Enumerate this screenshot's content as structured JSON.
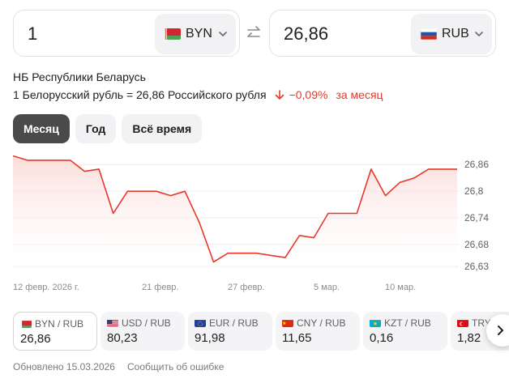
{
  "converter": {
    "from_amount": "1",
    "from_currency": "BYN",
    "to_amount": "26,86",
    "to_currency": "RUB"
  },
  "info": {
    "source": "НБ Республики Беларусь",
    "rate_text": "1 Белорусский рубль = 26,86 Российского рубля",
    "change": "−0,09%",
    "change_period": "за месяц"
  },
  "periods": [
    {
      "label": "Месяц",
      "active": true
    },
    {
      "label": "Год",
      "active": false
    },
    {
      "label": "Всё время",
      "active": false
    }
  ],
  "chart_data": {
    "type": "area",
    "title": "",
    "xlabel": "",
    "ylabel": "",
    "ylim": [
      26.61,
      26.89
    ],
    "y_ticks": [
      "26,86",
      "26,8",
      "26,74",
      "26,68",
      "26,63"
    ],
    "y_tick_values": [
      26.86,
      26.8,
      26.74,
      26.68,
      26.63
    ],
    "x_tick_labels": [
      "12 февр. 2026 г.",
      "21 февр.",
      "27 февр.",
      "5 мар.",
      "10 мар."
    ],
    "series": [
      {
        "values": [
          26.88,
          26.87,
          26.87,
          26.87,
          26.87,
          26.845,
          26.85,
          26.75,
          26.8,
          26.8,
          26.8,
          26.79,
          26.8,
          26.73,
          26.64,
          26.66,
          26.66,
          26.66,
          26.655,
          26.65,
          26.7,
          26.695,
          26.75,
          26.75,
          26.75,
          26.85,
          26.79,
          26.82,
          26.83,
          26.85,
          26.85,
          26.85
        ]
      }
    ],
    "grid": true,
    "line_color": "#e8372a",
    "fill_color": "#fdecea"
  },
  "pairs": [
    {
      "label": "BYN / RUB",
      "value": "26,86",
      "flag": "by",
      "active": true
    },
    {
      "label": "USD / RUB",
      "value": "80,23",
      "flag": "us",
      "active": false
    },
    {
      "label": "EUR / RUB",
      "value": "91,98",
      "flag": "eu",
      "active": false
    },
    {
      "label": "CNY / RUB",
      "value": "11,65",
      "flag": "cn",
      "active": false
    },
    {
      "label": "KZT / RUB",
      "value": "0,16",
      "flag": "kz",
      "active": false
    },
    {
      "label": "TRY / RUB",
      "value": "1,82",
      "flag": "tr",
      "active": false
    }
  ],
  "footer": {
    "updated": "Обновлено 15.03.2026",
    "report": "Сообщить об ошибке"
  },
  "colors": {
    "accent_red": "#e8372a",
    "active_period": "#4a4a4a"
  }
}
